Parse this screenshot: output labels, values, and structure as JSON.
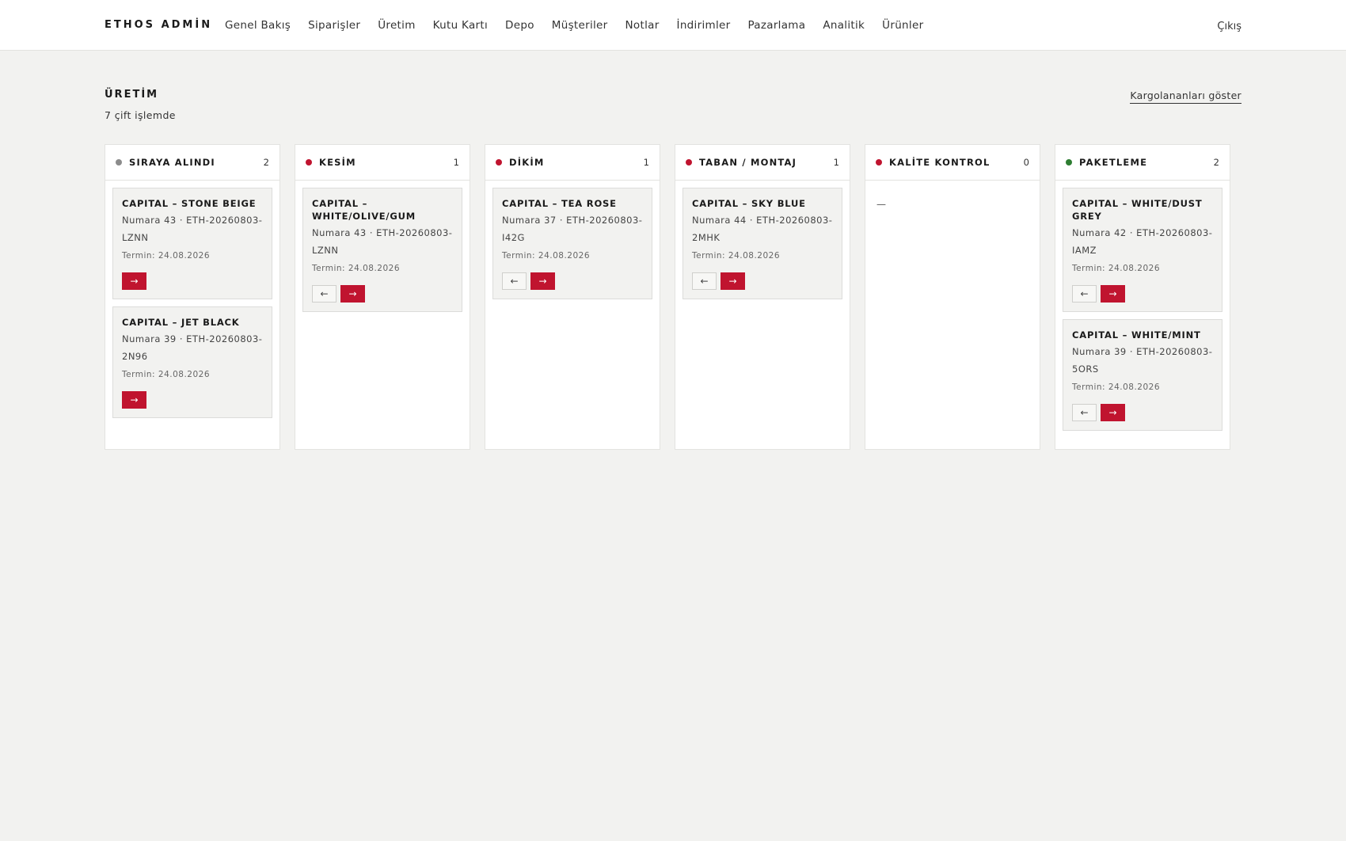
{
  "app": {
    "brand": "ETHOS ADMİN",
    "logout": "Çıkış"
  },
  "nav": [
    "Genel Bakış",
    "Siparişler",
    "Üretim",
    "Kutu Kartı",
    "Depo",
    "Müşteriler",
    "Notlar",
    "İndirimler",
    "Pazarlama",
    "Analitik",
    "Ürünler"
  ],
  "header": {
    "title": "ÜRETİM",
    "subtitle": "7 çift işlemde",
    "show_shipped": "Kargolananları göster"
  },
  "icons": {
    "back": "arrow-left-icon",
    "forward": "arrow-right-icon"
  },
  "colors": {
    "accent": "#c0142f",
    "queued": "#8c8c8c",
    "done": "#2e7d32"
  },
  "columns": [
    {
      "title": "SIRAYA ALINDI",
      "count": "2",
      "color": "#8c8c8c",
      "cards": [
        {
          "title": "CAPITAL – STONE BEIGE",
          "meta": "Numara 43 · ETH-20260803-LZNN",
          "due": "Termin: 24.08.2026",
          "back": false
        },
        {
          "title": "CAPITAL – JET BLACK",
          "meta": "Numara 39 · ETH-20260803-2N96",
          "due": "Termin: 24.08.2026",
          "back": false
        }
      ]
    },
    {
      "title": "KESİM",
      "count": "1",
      "color": "#c0142f",
      "cards": [
        {
          "title": "CAPITAL – WHITE/OLIVE/GUM",
          "meta": "Numara 43 · ETH-20260803-LZNN",
          "due": "Termin: 24.08.2026",
          "back": true
        }
      ]
    },
    {
      "title": "DİKİM",
      "count": "1",
      "color": "#c0142f",
      "cards": [
        {
          "title": "CAPITAL – TEA ROSE",
          "meta": "Numara 37 · ETH-20260803-I42G",
          "due": "Termin: 24.08.2026",
          "back": true
        }
      ]
    },
    {
      "title": "TABAN / MONTAJ",
      "count": "1",
      "color": "#c0142f",
      "cards": [
        {
          "title": "CAPITAL – SKY BLUE",
          "meta": "Numara 44 · ETH-20260803-2MHK",
          "due": "Termin: 24.08.2026",
          "back": true
        }
      ]
    },
    {
      "title": "KALİTE KONTROL",
      "count": "0",
      "color": "#c0142f",
      "empty": "—",
      "cards": []
    },
    {
      "title": "PAKETLEME",
      "count": "2",
      "color": "#2e7d32",
      "cards": [
        {
          "title": "CAPITAL – WHITE/DUST GREY",
          "meta": "Numara 42 · ETH-20260803-IAMZ",
          "due": "Termin: 24.08.2026",
          "back": true
        },
        {
          "title": "CAPITAL – WHITE/MINT",
          "meta": "Numara 39 · ETH-20260803-5ORS",
          "due": "Termin: 24.08.2026",
          "back": true
        }
      ]
    }
  ]
}
